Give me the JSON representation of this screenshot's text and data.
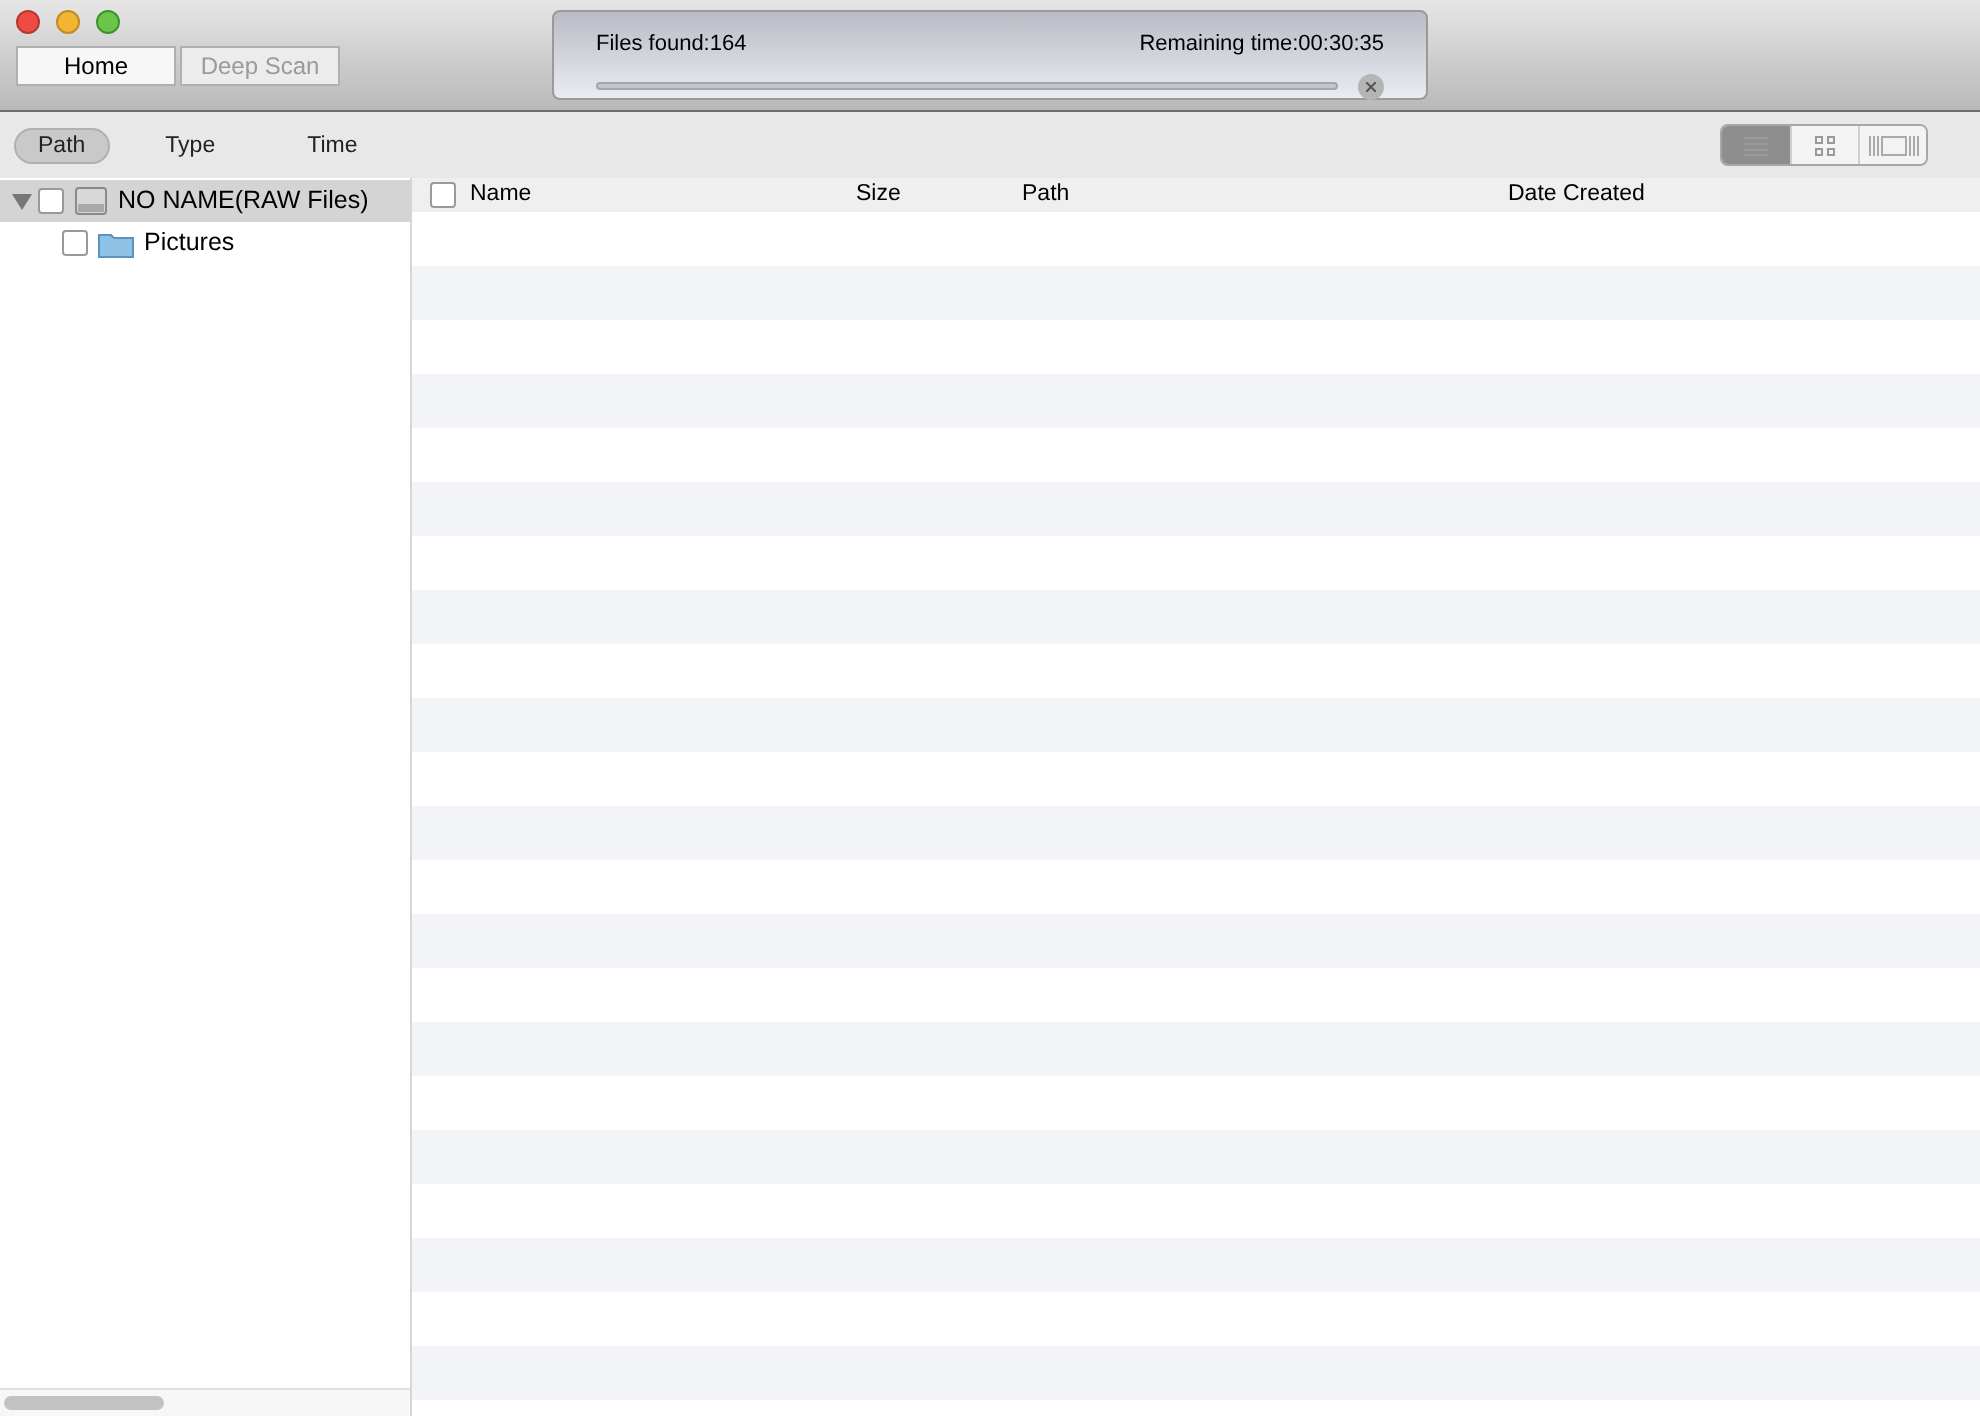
{
  "toolbar": {
    "buttons": [
      {
        "label": "Home",
        "disabled": false
      },
      {
        "label": "Deep Scan",
        "disabled": true
      }
    ]
  },
  "scan_status": {
    "files_found": "Files found:164",
    "remaining_time": "Remaining time:00:30:35"
  },
  "filter_tabs": [
    {
      "label": "Path",
      "selected": true
    },
    {
      "label": "Type",
      "selected": false
    },
    {
      "label": "Time",
      "selected": false
    }
  ],
  "view_modes": [
    {
      "kind": "list",
      "selected": true
    },
    {
      "kind": "grid",
      "selected": false
    },
    {
      "kind": "filmstrip",
      "selected": false
    }
  ],
  "tree": [
    {
      "label": "NO NAME(RAW Files)",
      "kind": "drive",
      "checked": false,
      "expanded": true,
      "selected": true,
      "children": [
        {
          "label": "Pictures",
          "kind": "folder",
          "checked": false,
          "selected": false
        }
      ]
    }
  ],
  "table": {
    "select_all_checked": false,
    "columns": [
      "Name",
      "Size",
      "Path",
      "Date Created"
    ]
  }
}
